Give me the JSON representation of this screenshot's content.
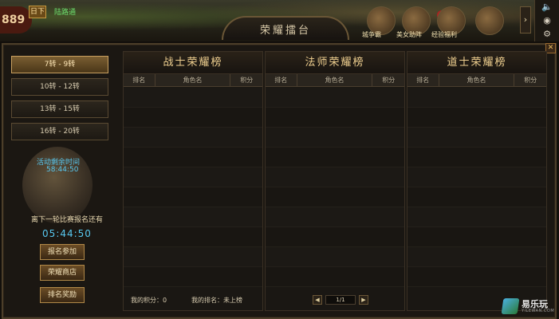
{
  "hud": {
    "hp_value": "889",
    "exit_label": "日下",
    "status_text": "陆路通",
    "arena_title": "荣耀擂台",
    "events": [
      {
        "label": "城争霸"
      },
      {
        "label": "美女助阵"
      },
      {
        "label": "经验福利"
      }
    ],
    "event_badge": "8"
  },
  "tiers": [
    {
      "label": "7转 - 9转",
      "active": true
    },
    {
      "label": "10转 - 12转",
      "active": false
    },
    {
      "label": "13转 - 15转",
      "active": false
    },
    {
      "label": "16转 - 20转",
      "active": false
    }
  ],
  "countdown": {
    "remain_label": "活动剩余时间",
    "remain_time": "58:44:50",
    "next_label": "离下一轮比赛报名还有",
    "next_time": "05:44:50"
  },
  "actions": {
    "signup": "报名参加",
    "shop": "荣耀商店",
    "rewards": "排名奖励"
  },
  "tables": [
    {
      "title": "战士荣耀榜",
      "cols": [
        "排名",
        "角色名",
        "积分"
      ]
    },
    {
      "title": "法师荣耀榜",
      "cols": [
        "排名",
        "角色名",
        "积分"
      ]
    },
    {
      "title": "道士荣耀榜",
      "cols": [
        "排名",
        "角色名",
        "积分"
      ]
    }
  ],
  "footer": {
    "my_score": "我的积分：0",
    "my_rank": "我的排名：未上榜",
    "page": "1/1",
    "prev": "◀",
    "next": "▶"
  },
  "watermark": {
    "text": "易乐玩",
    "sub": "YILEWAN.COM"
  },
  "colors": {
    "accent_gold": "#f0d090",
    "time_blue": "#58c8f0",
    "panel_bg": "#1b1712"
  }
}
